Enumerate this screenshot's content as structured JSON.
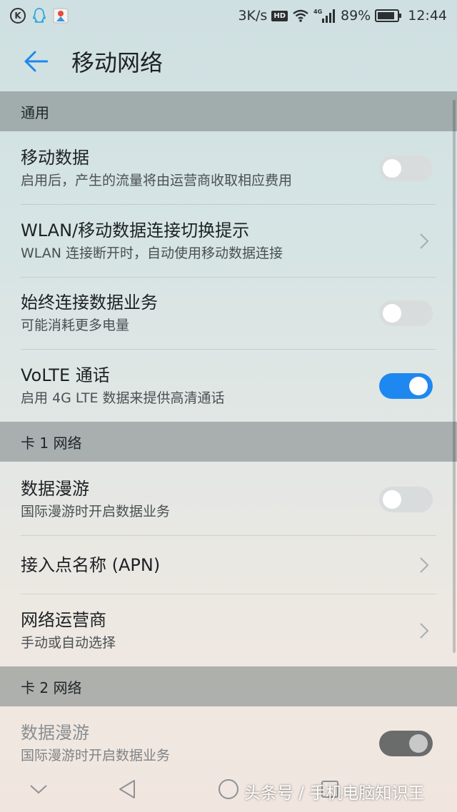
{
  "status_bar": {
    "speed": "3K/s",
    "hd": "HD",
    "network": "4G",
    "battery": "89%",
    "battery_level": 0.89,
    "time": "12:44"
  },
  "header": {
    "title": "移动网络",
    "back_icon": "arrow-left-icon",
    "accent": "#1e88f0"
  },
  "sections": {
    "general": "通用",
    "card1": "卡 1 网络",
    "card2": "卡 2 网络"
  },
  "rows": {
    "mobile_data": {
      "title": "移动数据",
      "subtitle": "启用后，产生的流量将由运营商收取相应费用",
      "state": "off"
    },
    "wlan_switch": {
      "title": "WLAN/移动数据连接切换提示",
      "subtitle": "WLAN 连接断开时，自动使用移动数据连接"
    },
    "always_on": {
      "title": "始终连接数据业务",
      "subtitle": "可能消耗更多电量",
      "state": "off"
    },
    "volte": {
      "title": "VoLTE 通话",
      "subtitle": "启用 4G LTE 数据来提供高清通话",
      "state": "on"
    },
    "card1_roaming": {
      "title": "数据漫游",
      "subtitle": "国际漫游时开启数据业务",
      "state": "off"
    },
    "apn": {
      "title": "接入点名称 (APN)"
    },
    "operator": {
      "title": "网络运营商",
      "subtitle": "手动或自动选择"
    },
    "card2_roaming": {
      "title": "数据漫游",
      "subtitle": "国际漫游时开启数据业务",
      "state": "on-disabled"
    }
  },
  "watermark": "头条号 / 手机电脑知识王"
}
